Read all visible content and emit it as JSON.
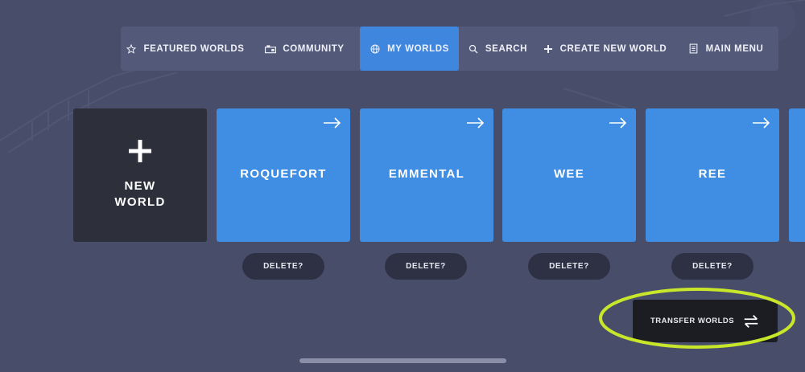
{
  "nav": {
    "items": [
      {
        "label": "FEATURED WORLDS",
        "icon": "star-icon"
      },
      {
        "label": "COMMUNITY",
        "icon": "community-icon"
      },
      {
        "label": "MY WORLDS",
        "icon": "globe-icon",
        "active": true
      },
      {
        "label": "SEARCH",
        "icon": "search-icon"
      },
      {
        "label": "CREATE NEW WORLD",
        "icon": "plus-icon"
      },
      {
        "label": "MAIN MENU",
        "icon": "menu-icon"
      }
    ]
  },
  "worlds": {
    "new_world_label_line1": "NEW",
    "new_world_label_line2": "WORLD",
    "items": [
      {
        "name": "ROQUEFORT",
        "delete_label": "DELETE?"
      },
      {
        "name": "EMMENTAL",
        "delete_label": "DELETE?"
      },
      {
        "name": "WEE",
        "delete_label": "DELETE?"
      },
      {
        "name": "REE",
        "delete_label": "DELETE?"
      }
    ]
  },
  "transfer": {
    "label": "TRANSFER WORLDS",
    "icon": "transfer-arrows-icon"
  },
  "colors": {
    "background": "#484d6a",
    "nav_bar": "#535a79",
    "accent": "#3f86de",
    "world_card": "#3f8ee3",
    "new_world_card": "#2d2f3a",
    "highlight_ring": "#c8e62a"
  }
}
